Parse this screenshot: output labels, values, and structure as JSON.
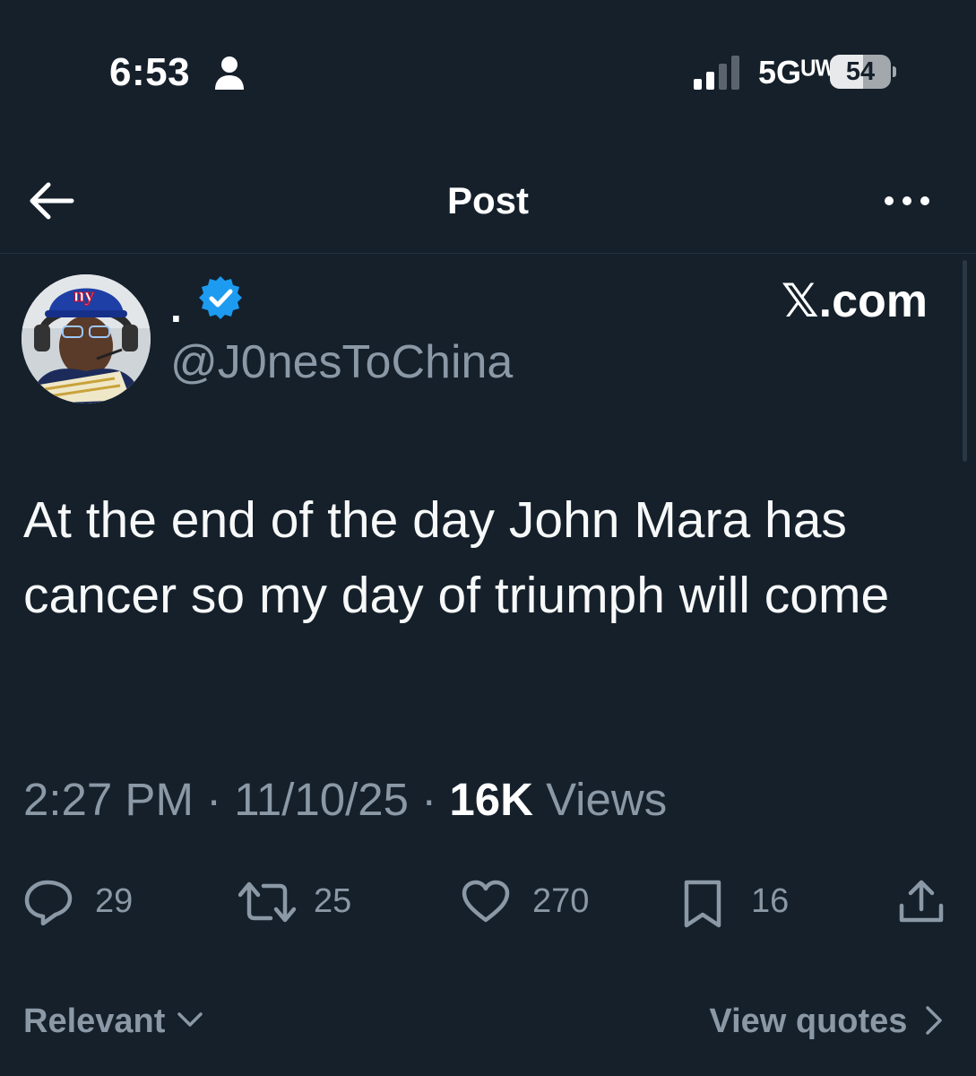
{
  "status_bar": {
    "time": "6:53",
    "network": "5Gᵁᵂ",
    "battery": "54",
    "battery_level": 0.54
  },
  "header": {
    "title": "Post"
  },
  "author": {
    "display_name": ".",
    "handle": "@J0nesToChina",
    "verified": true,
    "source_label": "𝕏.com",
    "avatar_cap_text": "ny"
  },
  "post": {
    "text": "At the end of the day John Mara has cancer so my day of triumph will come",
    "time": "2:27 PM",
    "date": "11/10/25",
    "separator": "·",
    "views_count": "16K",
    "views_label": "Views"
  },
  "actions": {
    "replies": "29",
    "reposts": "25",
    "likes": "270",
    "bookmarks": "16"
  },
  "footer": {
    "sort_label": "Relevant",
    "view_quotes_label": "View quotes"
  },
  "colors": {
    "background": "#15202b",
    "text_primary": "#f7f9f9",
    "text_secondary": "#8b98a5",
    "verified": "#1d9bf0"
  },
  "icons": [
    "person-icon",
    "signal-icon",
    "back-arrow-icon",
    "more-icon",
    "verified-badge-icon",
    "reply-icon",
    "repost-icon",
    "like-icon",
    "bookmark-icon",
    "share-icon",
    "chevron-down-icon",
    "chevron-right-icon"
  ]
}
